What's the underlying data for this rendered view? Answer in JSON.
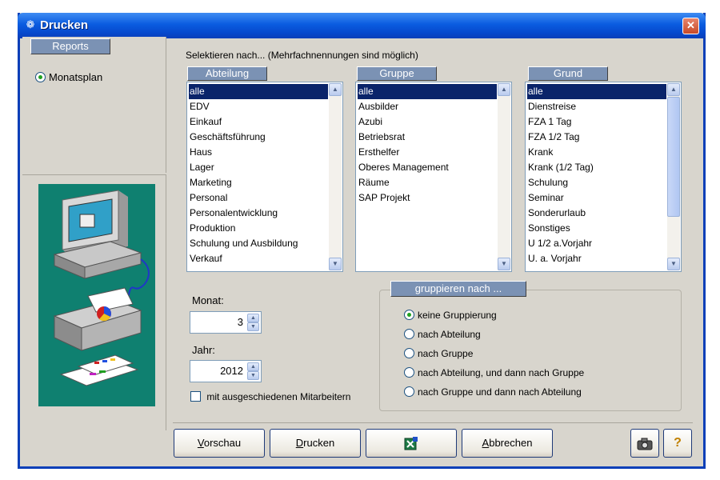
{
  "window": {
    "title": "Drucken"
  },
  "sidebar": {
    "reports_header": "Reports",
    "options": [
      {
        "label": "Monatsplan",
        "selected": true
      }
    ]
  },
  "selection": {
    "label": "Selektieren nach... (Mehrfachnennungen sind möglich)",
    "abteilung": {
      "header": "Abteilung",
      "items": [
        "alle",
        "EDV",
        "Einkauf",
        "Geschäftsführung",
        "Haus",
        "Lager",
        "Marketing",
        "Personal",
        "Personalentwicklung",
        "Produktion",
        "Schulung und Ausbildung",
        "Verkauf"
      ],
      "selected": "alle"
    },
    "gruppe": {
      "header": "Gruppe",
      "items": [
        "alle",
        "Ausbilder",
        "Azubi",
        "Betriebsrat",
        "Ersthelfer",
        "Oberes Management",
        "Räume",
        "SAP Projekt"
      ],
      "selected": "alle"
    },
    "grund": {
      "header": "Grund",
      "items": [
        "alle",
        "Dienstreise",
        "FZA 1  Tag",
        "FZA 1/2 Tag",
        "Krank",
        "Krank (1/2 Tag)",
        "Schulung",
        "Seminar",
        "Sonderurlaub",
        "Sonstiges",
        "U 1/2 a.Vorjahr",
        "U. a. Vorjahr"
      ],
      "selected": "alle"
    }
  },
  "period": {
    "month_label": "Monat:",
    "month_value": "3",
    "year_label": "Jahr:",
    "year_value": "2012",
    "include_departed_label": "mit ausgeschiedenen Mitarbeitern",
    "include_departed_checked": false
  },
  "grouping": {
    "header": "gruppieren nach ...",
    "options": [
      {
        "label": "keine Gruppierung",
        "selected": true
      },
      {
        "label": "nach Abteilung",
        "selected": false
      },
      {
        "label": "nach Gruppe",
        "selected": false
      },
      {
        "label": "nach Abteilung, und dann nach Gruppe",
        "selected": false
      },
      {
        "label": "nach Gruppe und dann nach Abteilung",
        "selected": false
      }
    ]
  },
  "buttons": {
    "preview_mnemonic": "V",
    "preview_rest": "orschau",
    "print_mnemonic": "D",
    "print_rest": "rucken",
    "cancel_mnemonic": "A",
    "cancel_rest": "bbrechen",
    "excel_icon": "excel-export-icon",
    "camera_icon": "camera-icon",
    "help_icon": "help-icon",
    "help_glyph": "?"
  },
  "colors": {
    "titlebar": "#0a5ce0",
    "header_tab": "#7b92b4",
    "selection": "#0a246a",
    "illustration_bg": "#0f8070"
  }
}
